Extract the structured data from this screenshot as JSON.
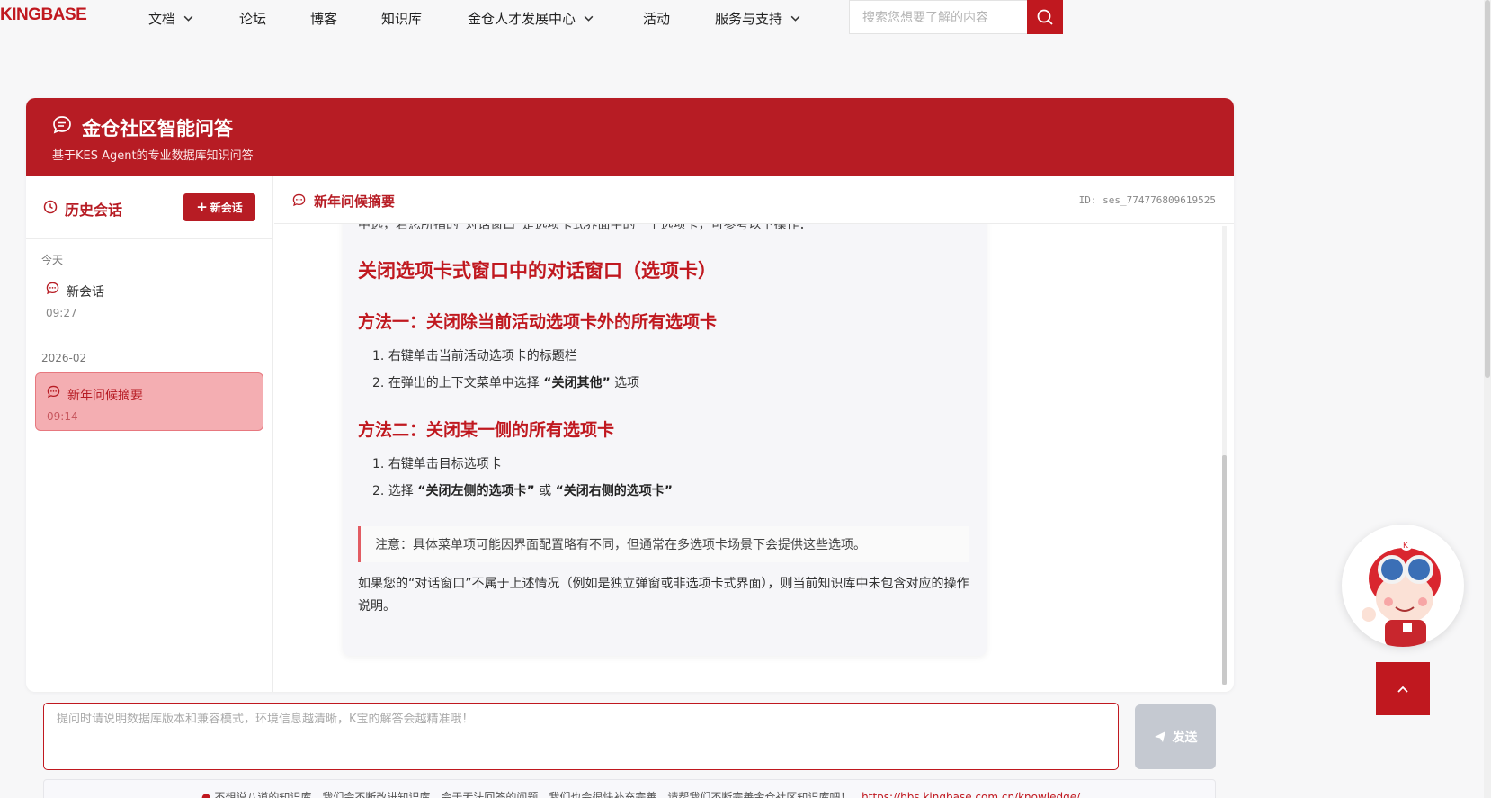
{
  "nav": {
    "logo": "KINGBASE",
    "items": [
      {
        "label": "文档",
        "has_dropdown": true
      },
      {
        "label": "论坛",
        "has_dropdown": false
      },
      {
        "label": "博客",
        "has_dropdown": false
      },
      {
        "label": "知识库",
        "has_dropdown": false
      },
      {
        "label": "金仓人才发展中心",
        "has_dropdown": true
      },
      {
        "label": "活动",
        "has_dropdown": false
      },
      {
        "label": "服务与支持",
        "has_dropdown": true
      }
    ],
    "search_placeholder": "搜索您想要了解的内容",
    "search_icon": "search-icon"
  },
  "panel": {
    "title": "金仓社区智能问答",
    "subtitle": "基于KES Agent的专业数据库知识问答",
    "accent_color": "#b71c24"
  },
  "sidebar": {
    "title": "历史会话",
    "new_button": "新会话",
    "groups": [
      {
        "label": "今天",
        "sessions": [
          {
            "title": "新会话",
            "time": "09:27",
            "active": false
          }
        ]
      },
      {
        "label": "2026-02",
        "sessions": [
          {
            "title": "新年问候摘要",
            "time": "09:14",
            "active": true
          }
        ]
      }
    ]
  },
  "chat": {
    "title": "新年问候摘要",
    "session_id": "ID: ses_774776809619525",
    "message": {
      "partial_line": "中选，若您所指的“对话窗口”是选项卡式界面中的一个选项卡，可参考以下操作：",
      "heading": "关闭选项卡式窗口中的对话窗口（选项卡）",
      "method1": {
        "heading": "方法一：关闭除当前活动选项卡外的所有选项卡",
        "steps": [
          {
            "num": "1.",
            "text": "右键单击当前活动选项卡的标题栏",
            "bold": ""
          },
          {
            "num": "2.",
            "text": "在弹出的上下文菜单中选择",
            "bold": "“关闭其他”",
            "after": "选项"
          }
        ]
      },
      "method2": {
        "heading": "方法二：关闭某一侧的所有选项卡",
        "steps": [
          {
            "num": "1.",
            "text": "右键单击目标选项卡"
          },
          {
            "num": "2.",
            "text": "选择",
            "bold1": "“关闭左侧的选项卡”",
            "mid": "或",
            "bold2": "“关闭右侧的选项卡”"
          }
        ]
      },
      "note": "注意：具体菜单项可能因界面配置略有不同，但通常在多选项卡场景下会提供这些选项。",
      "closing": "如果您的“对话窗口”不属于上述情况（例如是独立弹窗或非选项卡式界面），则当前知识库中未包含对应的操作说明。"
    }
  },
  "composer": {
    "placeholder": "提问时请说明数据库版本和兼容模式，环境信息越清晰，K宝的解答会越精准哦！",
    "send": "发送"
  },
  "notice": {
    "text": "不想说八道的知识库，我们会不断改进知识库，会于无法回答的问题，我们也会很快补充完善，请帮我们不断完善金仓社区知识库吧！",
    "link": "https://bbs.kingbase.com.cn/knowledge/"
  }
}
